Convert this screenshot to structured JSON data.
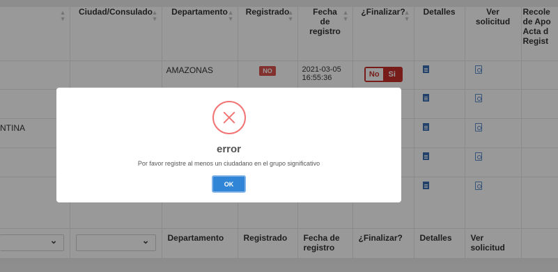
{
  "table": {
    "headers": {
      "col0": "",
      "ciudad": "Ciudad/Consulado",
      "departamento": "Departamento",
      "registrado": "Registrado",
      "fecha_line1": "Fecha",
      "fecha_line2": "de",
      "fecha_line3": "registro",
      "finalizar": "¿Finalizar?",
      "detalles": "Detalles",
      "ver_line1": "Ver",
      "ver_line2": "solicitud",
      "last_line1": "Recole",
      "last_line2": "de Apo",
      "last_line3": "Acta d",
      "last_line4": "Regist"
    },
    "rows": [
      {
        "departamento": "AMAZONAS",
        "registrado": "NO",
        "fecha_line1": "2021-03-05",
        "fecha_line2": "16:55:36",
        "toggle_no": "No",
        "toggle_si": "Si"
      },
      {
        "col0": ""
      },
      {
        "col0": "NTINA"
      },
      {
        "col0": ""
      },
      {
        "col0": ""
      }
    ],
    "footer": {
      "departamento": "Departamento",
      "registrado": "Registrado",
      "fecha_line1": "Fecha de",
      "fecha_line2": "registro",
      "finalizar": "¿Finalizar?",
      "detalles": "Detalles",
      "ver_line1": "Ver",
      "ver_line2": "solicitud"
    }
  },
  "dialog": {
    "icon": "error-x-icon",
    "title": "error",
    "message": "Por favor registre al menos un ciudadano en el grupo significativo",
    "ok_label": "OK",
    "accent_color": "#f27474",
    "button_color": "#3085d6"
  },
  "colors": {
    "badge_no": "#d9534f",
    "toggle": "#c9302c",
    "doc_icon": "#3a6fb3"
  }
}
